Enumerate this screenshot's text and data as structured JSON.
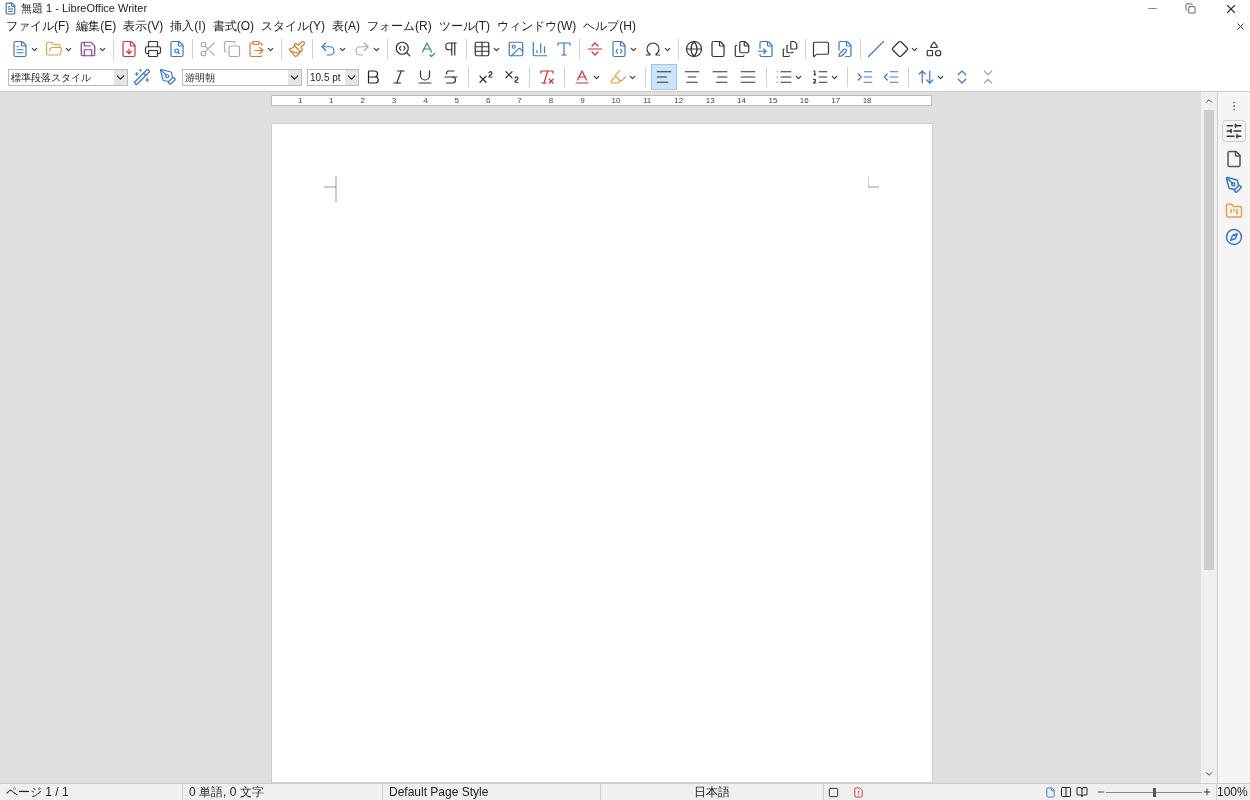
{
  "window": {
    "title": "無題 1 - LibreOffice Writer"
  },
  "menu": [
    "ファイル(F)",
    "編集(E)",
    "表示(V)",
    "挿入(I)",
    "書式(O)",
    "スタイル(Y)",
    "表(A)",
    "フォーム(R)",
    "ツール(T)",
    "ウィンドウ(W)",
    "ヘルプ(H)"
  ],
  "formatting": {
    "paragraph_style": "標準段落スタイル",
    "font_name": "游明朝",
    "font_size": "10.5 pt",
    "alignment": [
      {
        "selected": true
      },
      {
        "selected": false
      },
      {
        "selected": false
      },
      {
        "selected": false
      }
    ]
  },
  "ruler": {
    "labels": [
      "1",
      "1",
      "2",
      "3",
      "4",
      "5",
      "6",
      "7",
      "8",
      "9",
      "10",
      "11",
      "12",
      "13",
      "14",
      "15",
      "16",
      "17",
      "18"
    ]
  },
  "status_bar": {
    "page": "ページ 1 / 1",
    "words": "0 単語, 0 文字",
    "page_style": "Default Page Style",
    "language": "日本語",
    "zoom": "100%",
    "level": 0.5
  }
}
